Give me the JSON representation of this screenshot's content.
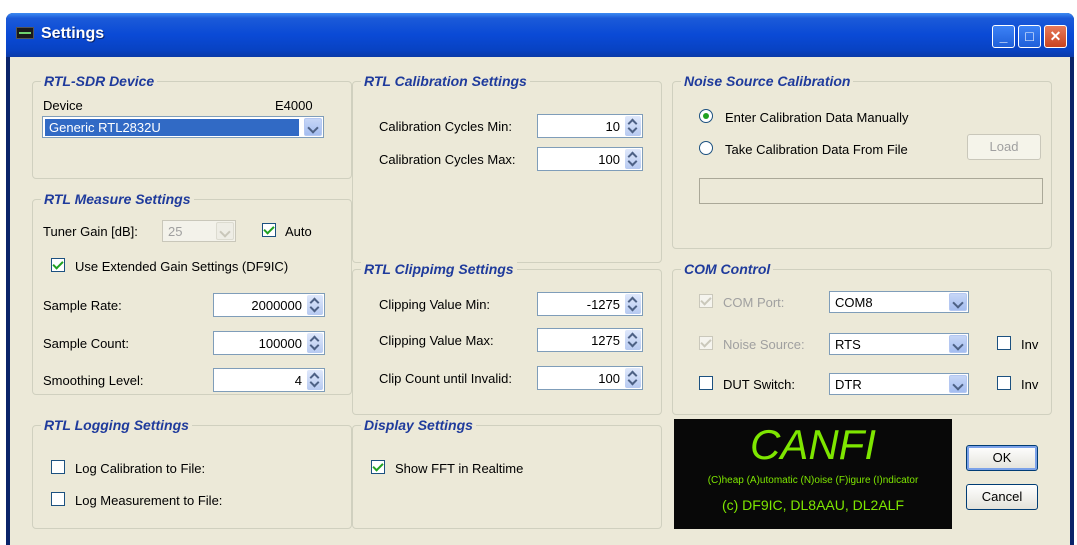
{
  "window": {
    "title": "Settings"
  },
  "rtl_device": {
    "title": "RTL-SDR Device",
    "device_label": "Device",
    "tuner": "E4000",
    "device_value": "Generic RTL2832U"
  },
  "measure": {
    "title": "RTL Measure Settings",
    "tuner_gain_label": "Tuner Gain [dB]:",
    "tuner_gain_value": "25",
    "auto_label": "Auto",
    "auto_checked": true,
    "extended_label": "Use Extended Gain Settings (DF9IC)",
    "extended_checked": true,
    "sample_rate_label": "Sample Rate:",
    "sample_rate_value": "2000000",
    "sample_count_label": "Sample Count:",
    "sample_count_value": "100000",
    "smoothing_label": "Smoothing Level:",
    "smoothing_value": "4"
  },
  "logging": {
    "title": "RTL Logging Settings",
    "log_cal_label": "Log Calibration to File:",
    "log_meas_label": "Log Measurement to File:"
  },
  "calibration": {
    "title": "RTL Calibration Settings",
    "min_label": "Calibration Cycles Min:",
    "min_value": "10",
    "max_label": "Calibration Cycles Max:",
    "max_value": "100"
  },
  "clipping": {
    "title": "RTL Clippimg Settings",
    "min_label": "Clipping Value Min:",
    "min_value": "-1275",
    "max_label": "Clipping Value Max:",
    "max_value": "1275",
    "count_label": "Clip Count until Invalid:",
    "count_value": "100"
  },
  "display": {
    "title": "Display Settings",
    "fft_label": "Show FFT in Realtime",
    "fft_checked": true
  },
  "noise": {
    "title": "Noise Source Calibration",
    "manual_label": "Enter Calibration Data Manually",
    "file_label": "Take Calibration Data From File",
    "load_label": "Load",
    "path_value": ""
  },
  "com": {
    "title": "COM Control",
    "port_label": "COM Port:",
    "port_value": "COM8",
    "noise_label": "Noise Source:",
    "noise_value": "RTS",
    "inv_label": "Inv",
    "dut_label": "DUT Switch:",
    "dut_value": "DTR",
    "inv2_label": "Inv"
  },
  "logo": {
    "name": "CANFI",
    "tagline": "(C)heap (A)utomatic (N)oise (F)igure (I)ndicator",
    "authors": "(c) DF9IC, DL8AAU, DL2ALF"
  },
  "buttons": {
    "ok": "OK",
    "cancel": "Cancel"
  },
  "colors": {
    "titlebar": "#0a4ad6",
    "group_title": "#1f3b9c",
    "logo_green": "#7ee600"
  }
}
